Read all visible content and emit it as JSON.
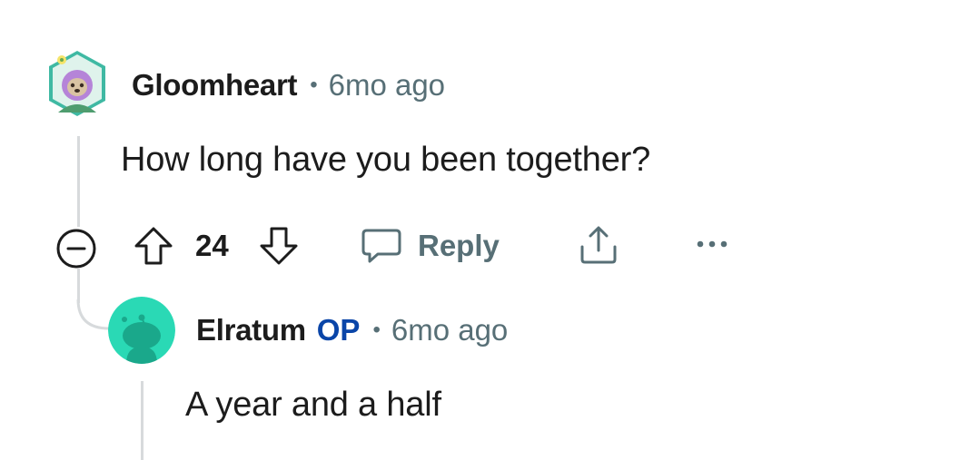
{
  "comments": [
    {
      "username": "Gloomheart",
      "timestamp": "6mo ago",
      "body": "How long have you been together?",
      "votes": "24",
      "reply_label": "Reply",
      "avatar_icon": "snoo-sloth-avatar-icon"
    },
    {
      "username": "Elratum",
      "op_badge": "OP",
      "timestamp": "6mo ago",
      "body": "A year and a half",
      "avatar_icon": "default-snoo-avatar-icon"
    }
  ],
  "separator": "•",
  "colors": {
    "text": "#1c1c1c",
    "muted": "#576f76",
    "op": "#0a45a8",
    "thread": "#d7dadc",
    "avatar_teal": "#2ad9b5"
  },
  "icons": [
    "collapse-icon",
    "upvote-icon",
    "downvote-icon",
    "comment-icon",
    "share-icon",
    "more-options-icon"
  ]
}
